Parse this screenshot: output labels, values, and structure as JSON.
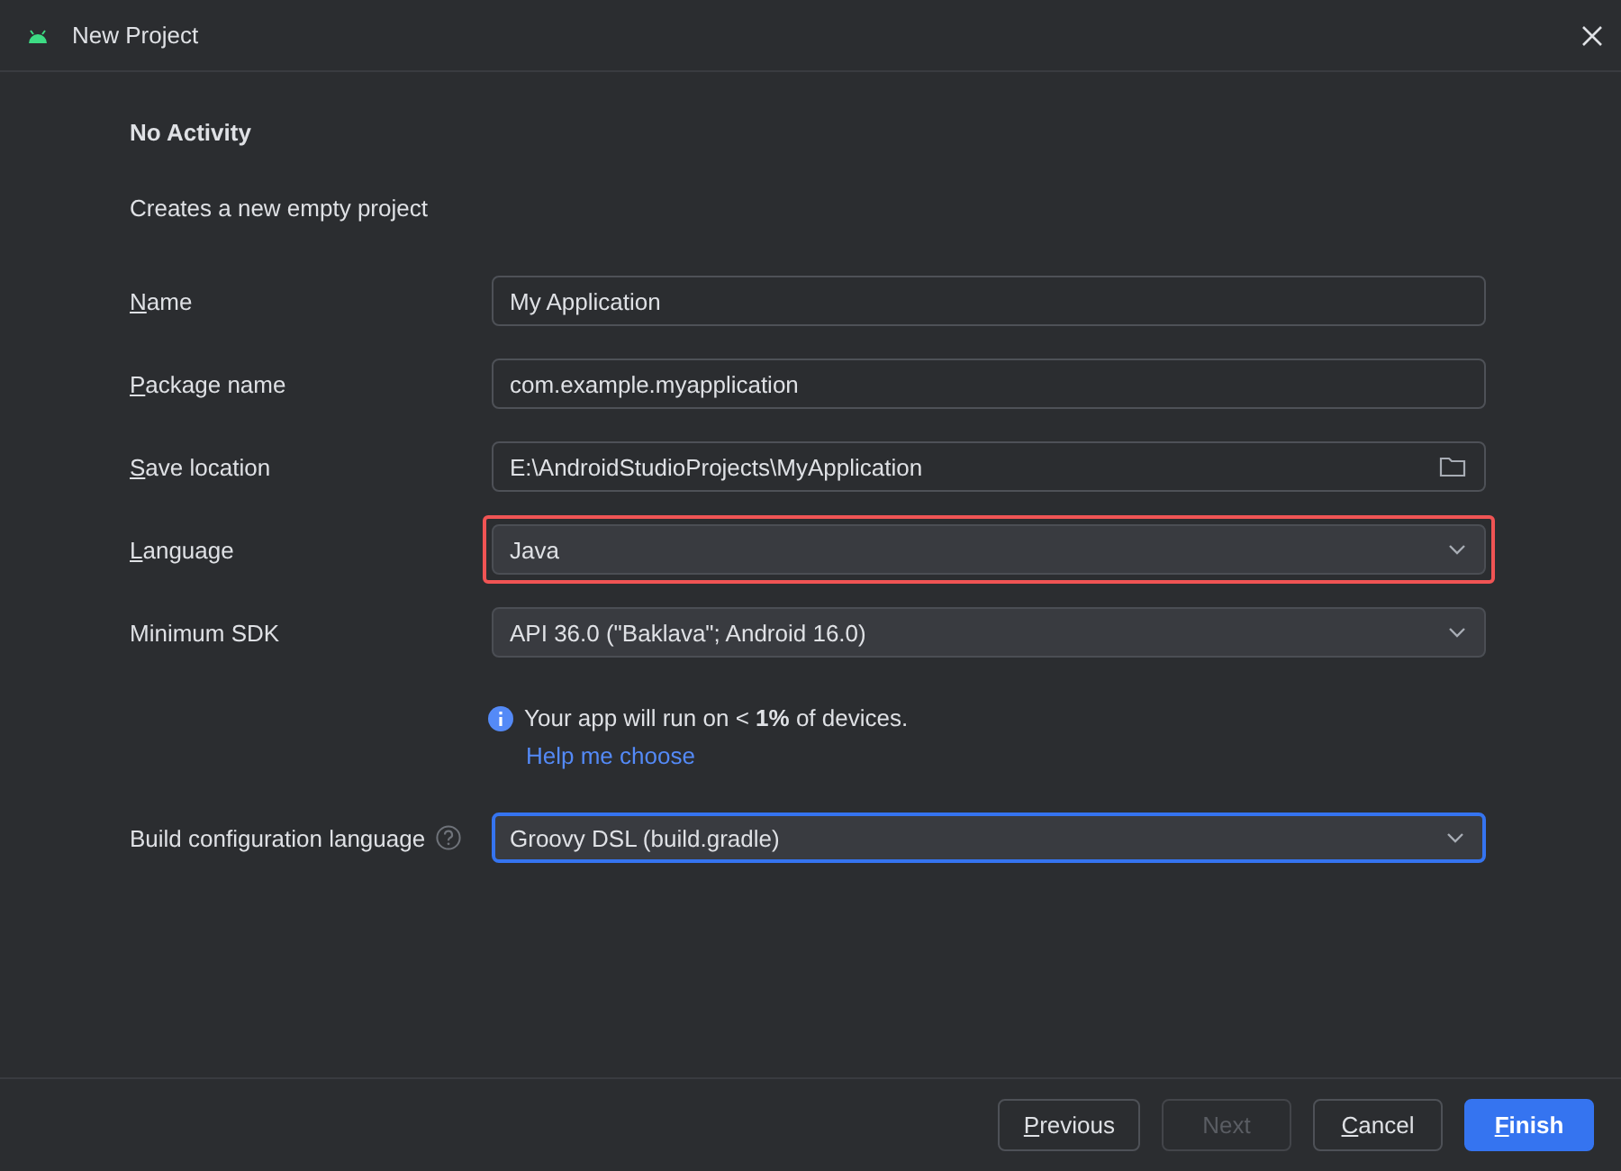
{
  "window": {
    "title": "New Project"
  },
  "heading": "No Activity",
  "description": "Creates a new empty project",
  "fields": [
    {
      "label": "Name",
      "mnemonic": true,
      "kind": "text",
      "value": "My Application",
      "focused": false,
      "highlighted": false
    },
    {
      "label": "Package name",
      "mnemonic": true,
      "kind": "text",
      "value": "com.example.myapplication",
      "focused": false,
      "highlighted": false
    },
    {
      "label": "Save location",
      "mnemonic": true,
      "kind": "folder",
      "value": "E:\\AndroidStudioProjects\\MyApplication",
      "focused": false,
      "highlighted": false
    },
    {
      "label": "Language",
      "mnemonic": true,
      "kind": "dropdown",
      "value": "Java",
      "focused": false,
      "highlighted": true
    },
    {
      "label": "Minimum SDK",
      "mnemonic": false,
      "kind": "dropdown",
      "value": "API 36.0 (\"Baklava\"; Android 16.0)",
      "focused": false,
      "highlighted": false
    }
  ],
  "info": {
    "message": "Your app will run on < **1%** of devices.",
    "link": "Help me choose"
  },
  "build_config": {
    "label": "Build configuration language",
    "mnemonic": false,
    "kind": "dropdown",
    "value": "Groovy DSL (build.gradle)",
    "focused": true,
    "highlighted": false
  },
  "buttons": [
    {
      "label": "Previous",
      "mnemonic": true,
      "primary": false,
      "disabled": false
    },
    {
      "label": "Next",
      "mnemonic": false,
      "primary": false,
      "disabled": true
    },
    {
      "label": "Cancel",
      "mnemonic": true,
      "primary": false,
      "disabled": false
    },
    {
      "label": "Finish",
      "mnemonic": true,
      "primary": true,
      "disabled": false
    }
  ]
}
